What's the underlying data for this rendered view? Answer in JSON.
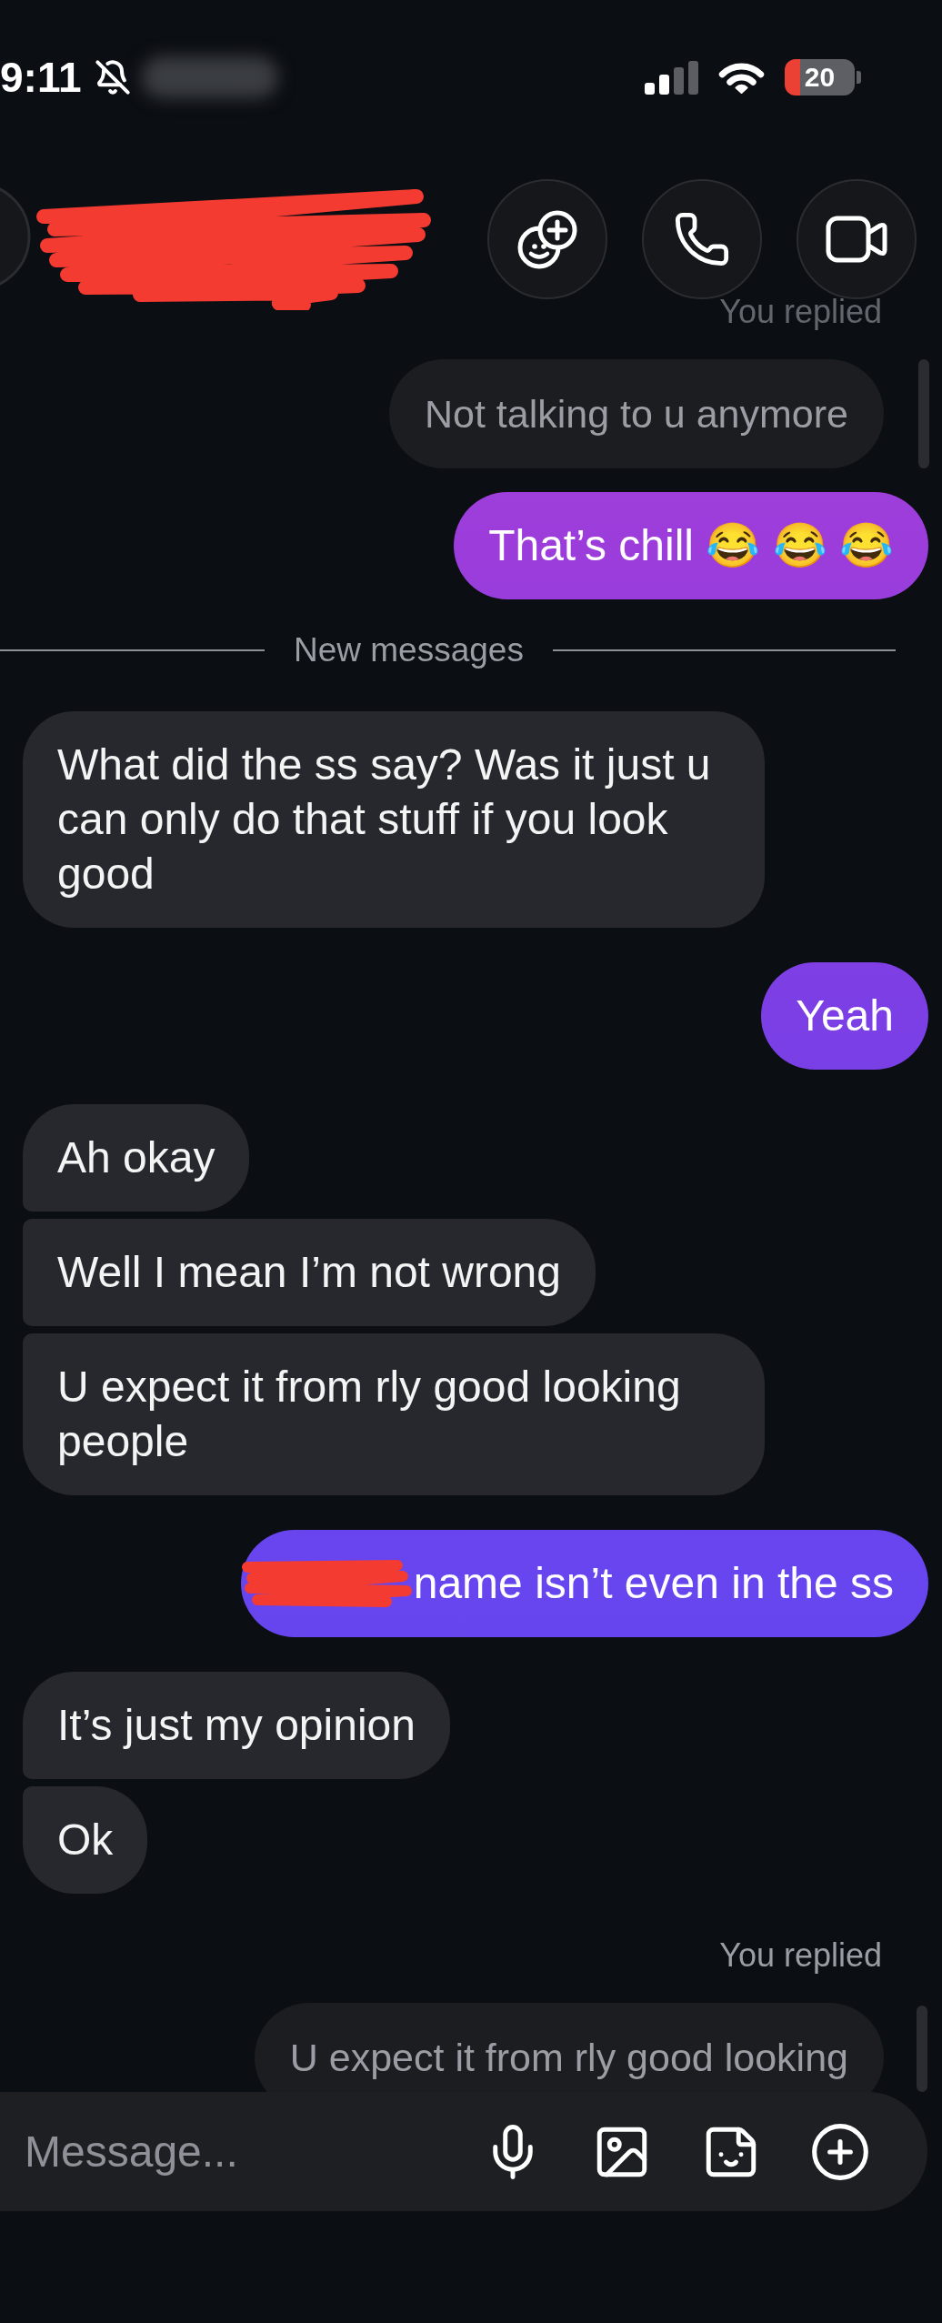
{
  "status_bar": {
    "time": "9:11",
    "silenced": true,
    "battery": "20"
  },
  "header": {
    "name_redacted": true
  },
  "messages": [
    {
      "kind": "reply_quote",
      "label": "You replied",
      "text": "Not talking to u anymore"
    },
    {
      "kind": "sent",
      "text": "That’s chill 😂 😂 😂",
      "redacted": false
    },
    {
      "kind": "divider",
      "text": "New messages"
    },
    {
      "kind": "received",
      "text": "What did the ss say? Was it just u can only do that stuff if you look good"
    },
    {
      "kind": "sent",
      "text": "Yeah",
      "redacted": false
    },
    {
      "kind": "received",
      "text": "Ah okay"
    },
    {
      "kind": "received",
      "text": "Well I mean I’m not wrong"
    },
    {
      "kind": "received",
      "text": "U expect it from rly good looking people"
    },
    {
      "kind": "sent",
      "text": "name isn’t even in the ss",
      "redacted": true
    },
    {
      "kind": "received",
      "text": "It’s just my opinion"
    },
    {
      "kind": "received",
      "text": "Ok"
    },
    {
      "kind": "reply_quote",
      "label": "You replied",
      "text": "U expect it from rly good looking"
    }
  ],
  "composer": {
    "placeholder": "Message..."
  }
}
